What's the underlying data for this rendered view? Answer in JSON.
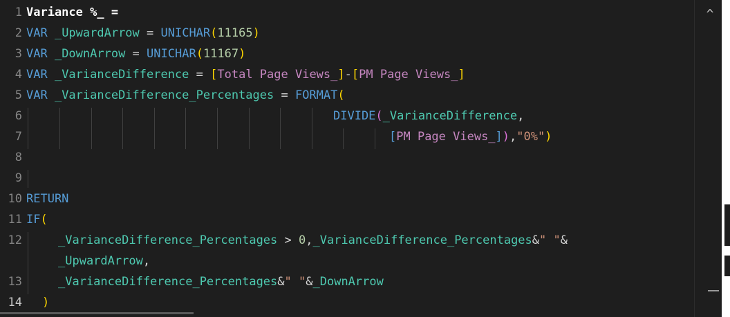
{
  "editor": {
    "line_numbers": [
      "1",
      "2",
      "3",
      "4",
      "5",
      "6",
      "7",
      "8",
      "9",
      "10",
      "11",
      "12",
      "",
      "13",
      "14"
    ],
    "lines": {
      "l1": {
        "name": "Variance %_",
        "eq": " ="
      },
      "l2": {
        "var": "VAR",
        "ident": " _UpwardArrow",
        "eq": " = ",
        "fn": "UNICHAR",
        "open": "(",
        "num": "11165",
        "close": ")"
      },
      "l3": {
        "var": "VAR",
        "ident": " _DownArrow",
        "eq": " = ",
        "fn": "UNICHAR",
        "open": "(",
        "num": "11167",
        "close": ")"
      },
      "l4": {
        "var": "VAR",
        "ident": " _VarianceDifference",
        "eq": " = ",
        "b1o": "[",
        "m1": "Total Page Views_",
        "b1c": "]",
        "minus": "-",
        "b2o": "[",
        "m2": "PM Page Views_",
        "b2c": "]"
      },
      "l5": {
        "var": "VAR",
        "ident": " _VarianceDifference_Percentages",
        "eq": " = ",
        "fn": "FORMAT",
        "open": "("
      },
      "l6": {
        "fn": "DIVIDE",
        "open": "(",
        "ident": "_VarianceDifference",
        "comma": ","
      },
      "l7": {
        "bo": "[",
        "m": "PM Page Views_",
        "bc": "]",
        "close1": ")",
        "comma": ",",
        "str": "\"0%\"",
        "close2": ")"
      },
      "l10": {
        "kw": "RETURN"
      },
      "l11": {
        "fn": "IF",
        "open": "("
      },
      "l12": {
        "ident": "_VarianceDifference_Percentages",
        "gt": " > ",
        "num": "0",
        "comma": ",",
        "ident2": "_VarianceDifference_Percentages",
        "amp": "&",
        "str": "\" \"",
        "amp2": "&"
      },
      "l12b": {
        "ident": "_UpwardArrow",
        "comma": ","
      },
      "l13": {
        "ident": "_VarianceDifference_Percentages",
        "amp": "&",
        "str": "\" \"",
        "amp2": "&",
        "ident2": "_DownArrow"
      },
      "l14": {
        "close": ")"
      }
    }
  },
  "scrollbar": {
    "up_icon": "^"
  }
}
